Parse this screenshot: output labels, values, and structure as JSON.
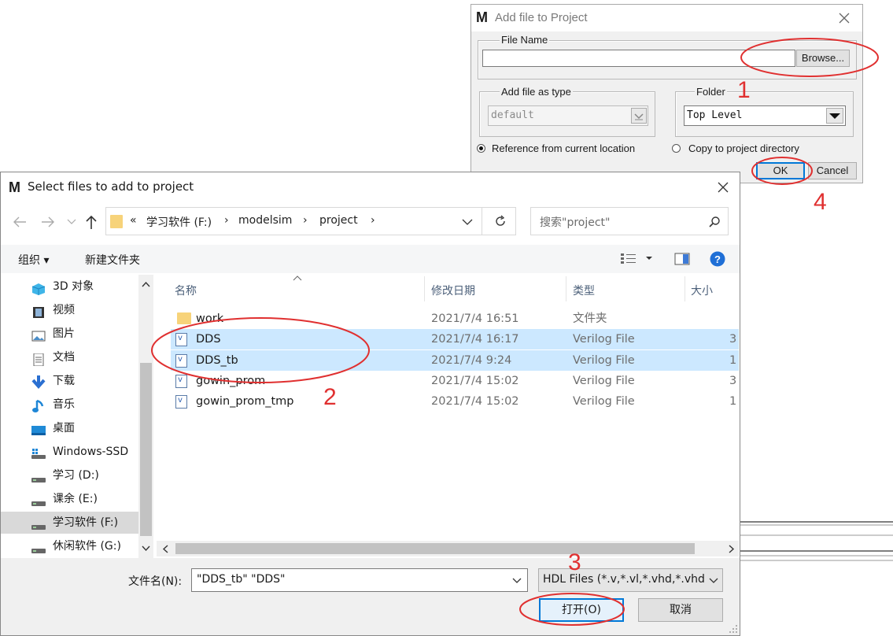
{
  "add_dialog": {
    "title": "Add file to Project",
    "logo": "M",
    "file_name_label": "File Name",
    "file_name_value": "",
    "browse_label": "Browse...",
    "type_label": "Add file as type",
    "type_value": "default",
    "folder_label": "Folder",
    "folder_value": "Top Level",
    "radio_reference": "Reference from current location",
    "radio_copy": "Copy to project directory",
    "ok_label": "OK",
    "cancel_label": "Cancel"
  },
  "select_dialog": {
    "title": "Select files to add to project",
    "logo": "M",
    "breadcrumb": [
      "学习软件 (F:)",
      "modelsim",
      "project"
    ],
    "breadcrumb_prefix": "«",
    "search_placeholder": "搜索\"project\"",
    "toolbar_organize": "组织 ▾",
    "toolbar_newfolder": "新建文件夹",
    "sidebar": [
      {
        "label": "3D 对象",
        "icon": "3d-objects-icon"
      },
      {
        "label": "视频",
        "icon": "video-icon"
      },
      {
        "label": "图片",
        "icon": "pictures-icon"
      },
      {
        "label": "文档",
        "icon": "documents-icon"
      },
      {
        "label": "下载",
        "icon": "download-icon"
      },
      {
        "label": "音乐",
        "icon": "music-icon"
      },
      {
        "label": "桌面",
        "icon": "desktop-icon"
      },
      {
        "label": "Windows-SSD",
        "icon": "drive-icon"
      },
      {
        "label": "学习 (D:)",
        "icon": "drive-icon"
      },
      {
        "label": "课余 (E:)",
        "icon": "drive-icon"
      },
      {
        "label": "学习软件 (F:)",
        "icon": "drive-icon"
      },
      {
        "label": "休闲软件 (G:)",
        "icon": "drive-icon"
      }
    ],
    "columns": {
      "name": "名称",
      "date": "修改日期",
      "type": "类型",
      "size": "大小"
    },
    "files": [
      {
        "name": "work",
        "date": "2021/7/4 16:51",
        "type": "文件夹",
        "size": "",
        "kind": "folder",
        "selected": false
      },
      {
        "name": "DDS",
        "date": "2021/7/4 16:17",
        "type": "Verilog File",
        "size": "3",
        "kind": "verilog",
        "selected": true
      },
      {
        "name": "DDS_tb",
        "date": "2021/7/4 9:24",
        "type": "Verilog File",
        "size": "1",
        "kind": "verilog",
        "selected": true
      },
      {
        "name": "gowin_prom",
        "date": "2021/7/4 15:02",
        "type": "Verilog File",
        "size": "3",
        "kind": "verilog",
        "selected": false
      },
      {
        "name": "gowin_prom_tmp",
        "date": "2021/7/4 15:02",
        "type": "Verilog File",
        "size": "1",
        "kind": "verilog",
        "selected": false
      }
    ],
    "filename_label": "文件名(N):",
    "filename_value": "\"DDS_tb\" \"DDS\"",
    "filter_value": "HDL Files (*.v,*.vl,*.vhd,*.vhdl,",
    "open_label": "打开(O)",
    "cancel_label": "取消"
  },
  "annotations": {
    "n1": "1",
    "n2": "2",
    "n3": "3",
    "n4": "4"
  },
  "colors": {
    "annotation_red": "#e03030",
    "selection": "#cce8ff",
    "help_blue": "#1f6fd6"
  }
}
